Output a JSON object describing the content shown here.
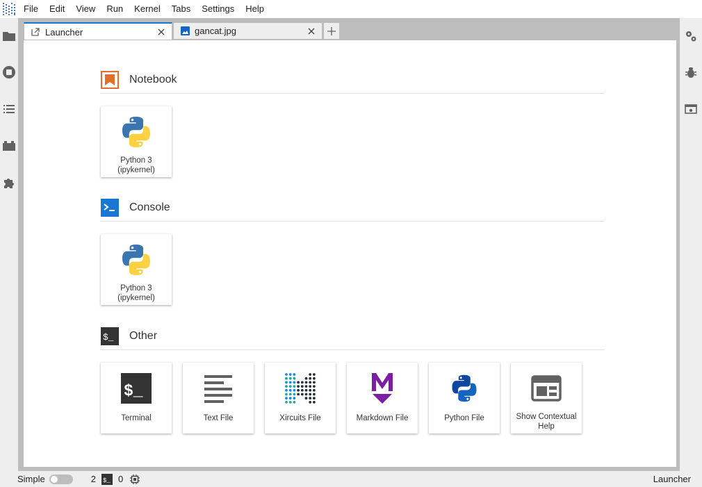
{
  "menubar": {
    "items": [
      "File",
      "Edit",
      "View",
      "Run",
      "Kernel",
      "Tabs",
      "Settings",
      "Help"
    ]
  },
  "left_sidebar": [
    "folder-icon",
    "running-icon",
    "toc-icon",
    "extension-manager-icon",
    "puzzle-icon"
  ],
  "right_sidebar": [
    "property-inspector-icon",
    "debugger-icon",
    "table-of-contents-icon"
  ],
  "tabs": [
    {
      "label": "Launcher",
      "icon": "launcher-icon",
      "active": true
    },
    {
      "label": "gancat.jpg",
      "icon": "image-icon",
      "active": false
    }
  ],
  "launcher": {
    "sections": {
      "notebook": {
        "title": "Notebook"
      },
      "console": {
        "title": "Console"
      },
      "other": {
        "title": "Other"
      }
    },
    "notebook_cards": [
      {
        "line1": "Python 3",
        "line2": "(ipykernel)"
      }
    ],
    "console_cards": [
      {
        "line1": "Python 3",
        "line2": "(ipykernel)"
      }
    ],
    "other_cards": [
      {
        "line1": "Terminal"
      },
      {
        "line1": "Text File"
      },
      {
        "line1": "Xircuits File"
      },
      {
        "line1": "Markdown File"
      },
      {
        "line1": "Python File"
      },
      {
        "line1": "Show Contextual",
        "line2": "Help"
      }
    ]
  },
  "statusbar": {
    "mode_label": "Simple",
    "terminals_count": "2",
    "kernels_count": "0",
    "right_label": "Launcher"
  },
  "colors": {
    "accent": "#1976d2",
    "notebook_orange": "#e46e2e",
    "console_blue": "#1976d2",
    "markdown_purple": "#7b1fa2"
  }
}
